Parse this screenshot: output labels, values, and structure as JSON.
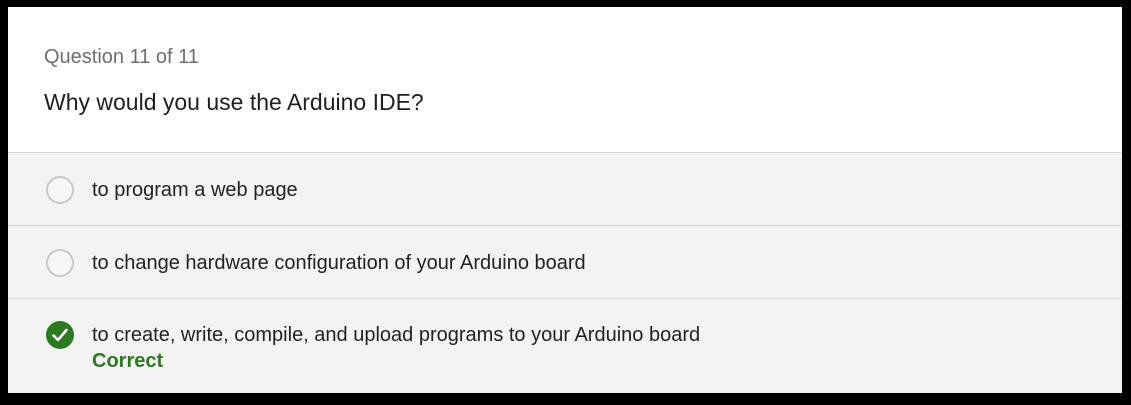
{
  "question": {
    "progress": "Question 11 of 11",
    "text": "Why would you use the Arduino IDE?"
  },
  "options": [
    {
      "label": "to program a web page",
      "selected": false
    },
    {
      "label": "to change hardware configuration of your Arduino board",
      "selected": false
    },
    {
      "label": "to create, write, compile, and upload programs to your Arduino board",
      "selected": true,
      "feedback": "Correct"
    }
  ],
  "colors": {
    "correct": "#2a7a1f",
    "option_bg": "#f3f3f3",
    "divider": "#d6d6d6"
  },
  "icons": {
    "selected_option": "checkmark-circle-icon",
    "unselected_option": "radio-circle-icon"
  }
}
